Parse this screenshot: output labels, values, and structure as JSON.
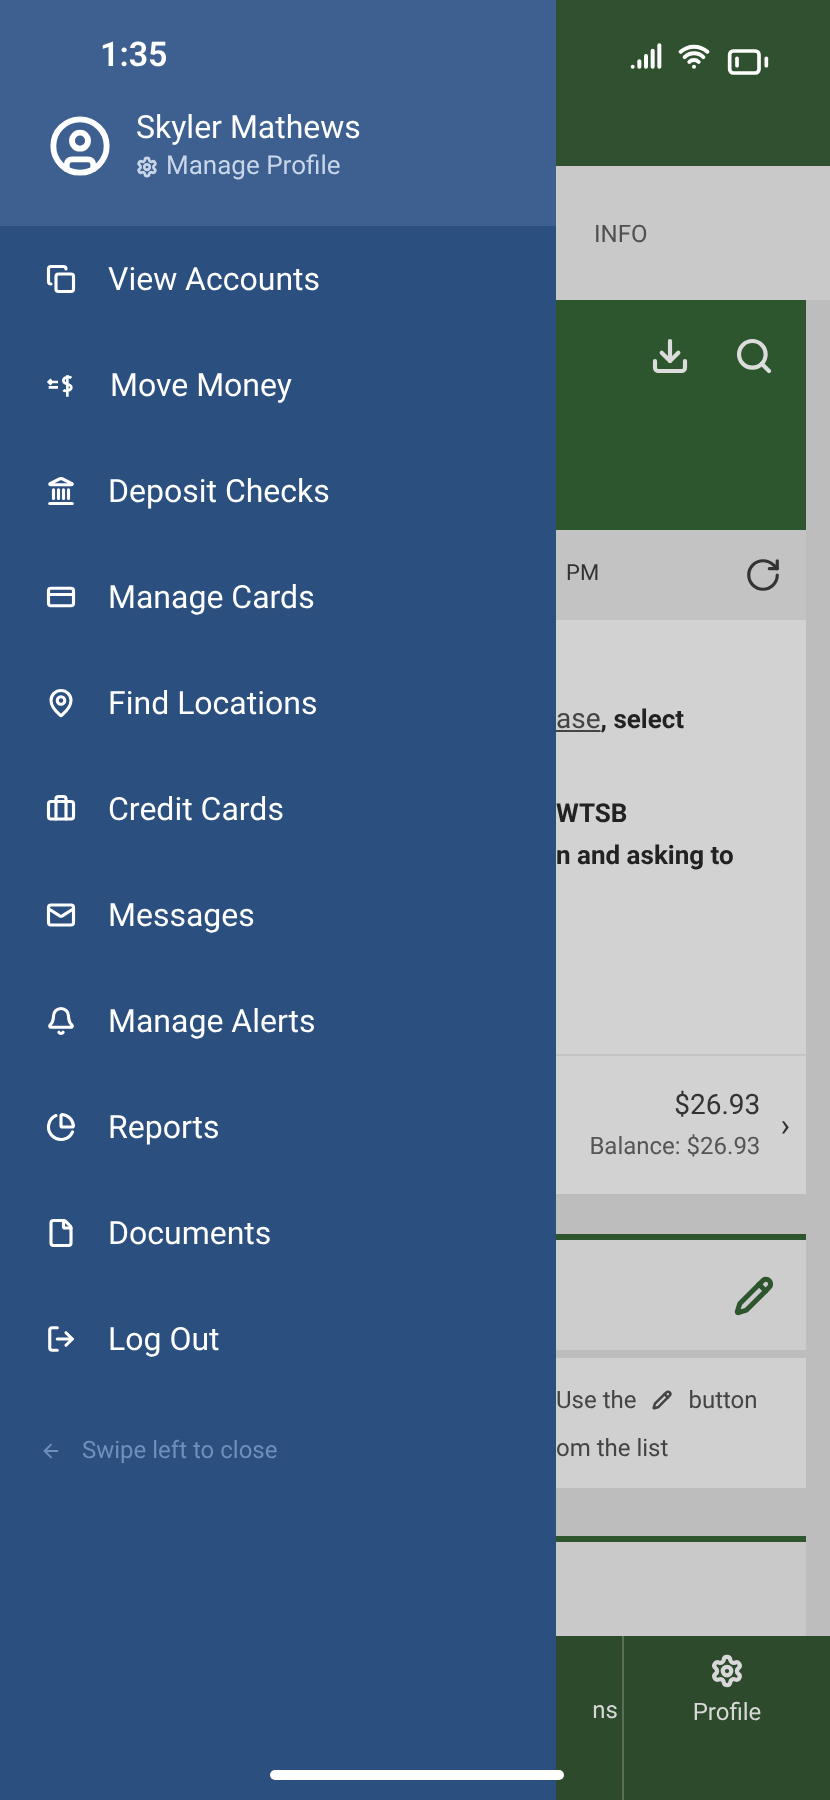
{
  "status_bar": {
    "time": "1:35"
  },
  "drawer": {
    "user": {
      "name": "Skyler Mathews",
      "link": "Manage Profile"
    },
    "items": [
      {
        "label": "View Accounts"
      },
      {
        "label": "Move Money"
      },
      {
        "label": "Deposit Checks"
      },
      {
        "label": "Manage Cards"
      },
      {
        "label": "Find Locations"
      },
      {
        "label": "Credit Cards"
      },
      {
        "label": "Messages"
      },
      {
        "label": "Manage Alerts"
      },
      {
        "label": "Reports"
      },
      {
        "label": "Documents"
      },
      {
        "label": "Log Out"
      }
    ],
    "hint": "Swipe left to close"
  },
  "background": {
    "tab": "INFO",
    "updated": "PM",
    "message": {
      "link": "ase",
      "rest": ", select",
      "lines": [
        "WTSB",
        "n and asking to"
      ]
    },
    "account": {
      "amount": "$26.93",
      "balance": "Balance: $26.93",
      "chevron": "›"
    },
    "tip": {
      "before": "Use the",
      "after": "button",
      "line2": "om the list"
    },
    "nav": [
      {
        "label": "ns"
      },
      {
        "label": "Profile"
      }
    ]
  }
}
